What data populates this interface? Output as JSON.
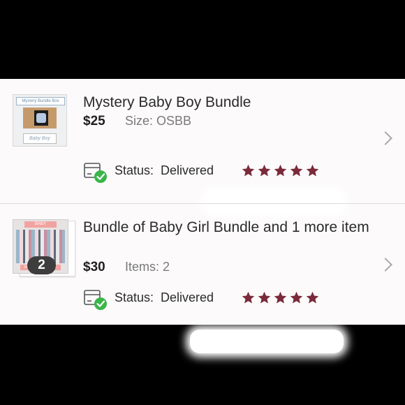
{
  "colors": {
    "accent_star": "#7a2a3a",
    "status_check": "#3ab54a",
    "panel_bg": "#fcfafb"
  },
  "orders": [
    {
      "title": "Mystery Baby Boy Bundle",
      "price": "$25",
      "meta": "Size: OSBB",
      "thumbnail_text_top": "Mystery Bundle Box",
      "thumbnail_text_bottom": "Baby Boy",
      "status_label": "Status:",
      "status_value": "Delivered",
      "rating": 5,
      "icons": {
        "status": "delivered-box-icon",
        "chevron": "chevron-right-icon",
        "star": "star-icon"
      }
    },
    {
      "title": "Bundle of Baby Girl Bundle and 1 more item",
      "price": "$30",
      "meta": "Items: 2",
      "thumbnail_text_top": "BABY",
      "thumbnail_text_bottom": "MYSTERY BUNDLE",
      "item_count": "2",
      "status_label": "Status:",
      "status_value": "Delivered",
      "rating": 5,
      "icons": {
        "status": "delivered-box-icon",
        "chevron": "chevron-right-icon",
        "star": "star-icon"
      }
    }
  ]
}
